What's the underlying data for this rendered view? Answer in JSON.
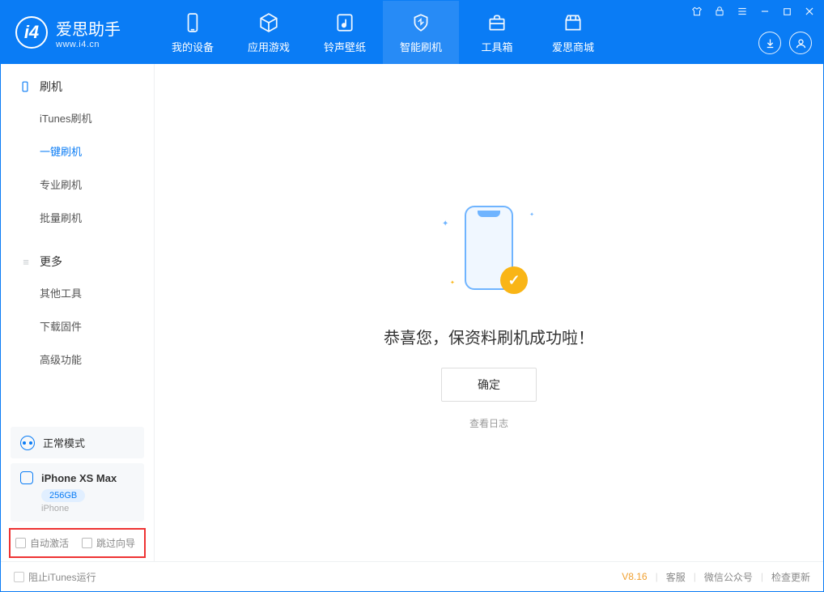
{
  "app": {
    "title": "爱思助手",
    "subtitle": "www.i4.cn"
  },
  "tabs": [
    {
      "label": "我的设备",
      "icon": "device"
    },
    {
      "label": "应用游戏",
      "icon": "cube"
    },
    {
      "label": "铃声壁纸",
      "icon": "music"
    },
    {
      "label": "智能刷机",
      "icon": "shield",
      "active": true
    },
    {
      "label": "工具箱",
      "icon": "toolbox"
    },
    {
      "label": "爱思商城",
      "icon": "store"
    }
  ],
  "sidebar": {
    "sections": [
      {
        "title": "刷机",
        "items": [
          "iTunes刷机",
          "一键刷机",
          "专业刷机",
          "批量刷机"
        ],
        "active_index": 1
      },
      {
        "title": "更多",
        "items": [
          "其他工具",
          "下载固件",
          "高级功能"
        ]
      }
    ],
    "mode": "正常模式",
    "device": {
      "name": "iPhone XS Max",
      "capacity": "256GB",
      "type": "iPhone"
    },
    "checkboxes": [
      "自动激活",
      "跳过向导"
    ]
  },
  "main": {
    "message": "恭喜您，保资料刷机成功啦！",
    "ok": "确定",
    "log_link": "查看日志"
  },
  "footer": {
    "block_itunes": "阻止iTunes运行",
    "version": "V8.16",
    "links": [
      "客服",
      "微信公众号",
      "检查更新"
    ]
  }
}
